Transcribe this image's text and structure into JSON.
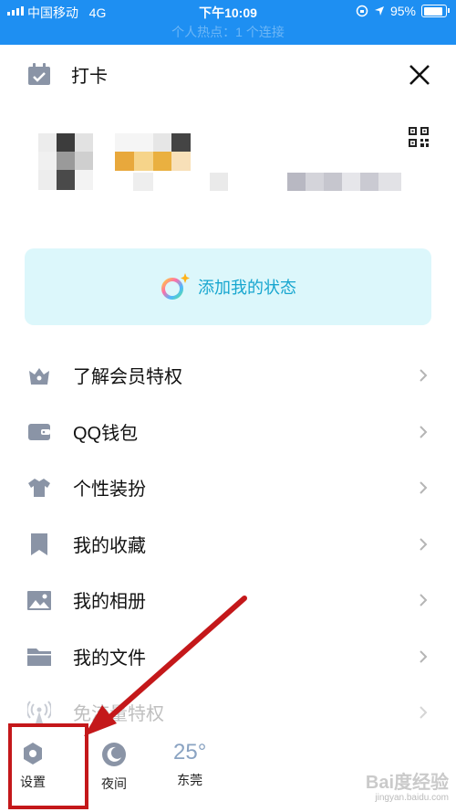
{
  "status_bar": {
    "carrier": "中国移动",
    "network": "4G",
    "time": "下午10:09",
    "battery": "95%",
    "battery_level": 0.95
  },
  "hot_banner": "个人热点：1 个连接",
  "header": {
    "checkin_label": "打卡"
  },
  "status_card": {
    "label": "添加我的状态"
  },
  "menu": [
    {
      "label": "了解会员特权",
      "icon": "crown-icon"
    },
    {
      "label": "QQ钱包",
      "icon": "wallet-icon"
    },
    {
      "label": "个性装扮",
      "icon": "tshirt-icon"
    },
    {
      "label": "我的收藏",
      "icon": "bookmark-icon"
    },
    {
      "label": "我的相册",
      "icon": "photo-icon"
    },
    {
      "label": "我的文件",
      "icon": "folder-icon"
    },
    {
      "label": "免流量特权",
      "icon": "antenna-icon"
    }
  ],
  "bottom": {
    "settings_label": "设置",
    "night_label": "夜间",
    "temperature": "25°",
    "city": "东莞"
  },
  "watermark": {
    "logo": "Bai度经验",
    "url": "jingyan.baidu.com"
  },
  "colors": {
    "accent": "#1e8ff2",
    "icon_gray": "#8a94a6",
    "card_bg": "#dcf7fb",
    "card_text": "#17a6cf",
    "annotation_red": "#c4181a"
  }
}
